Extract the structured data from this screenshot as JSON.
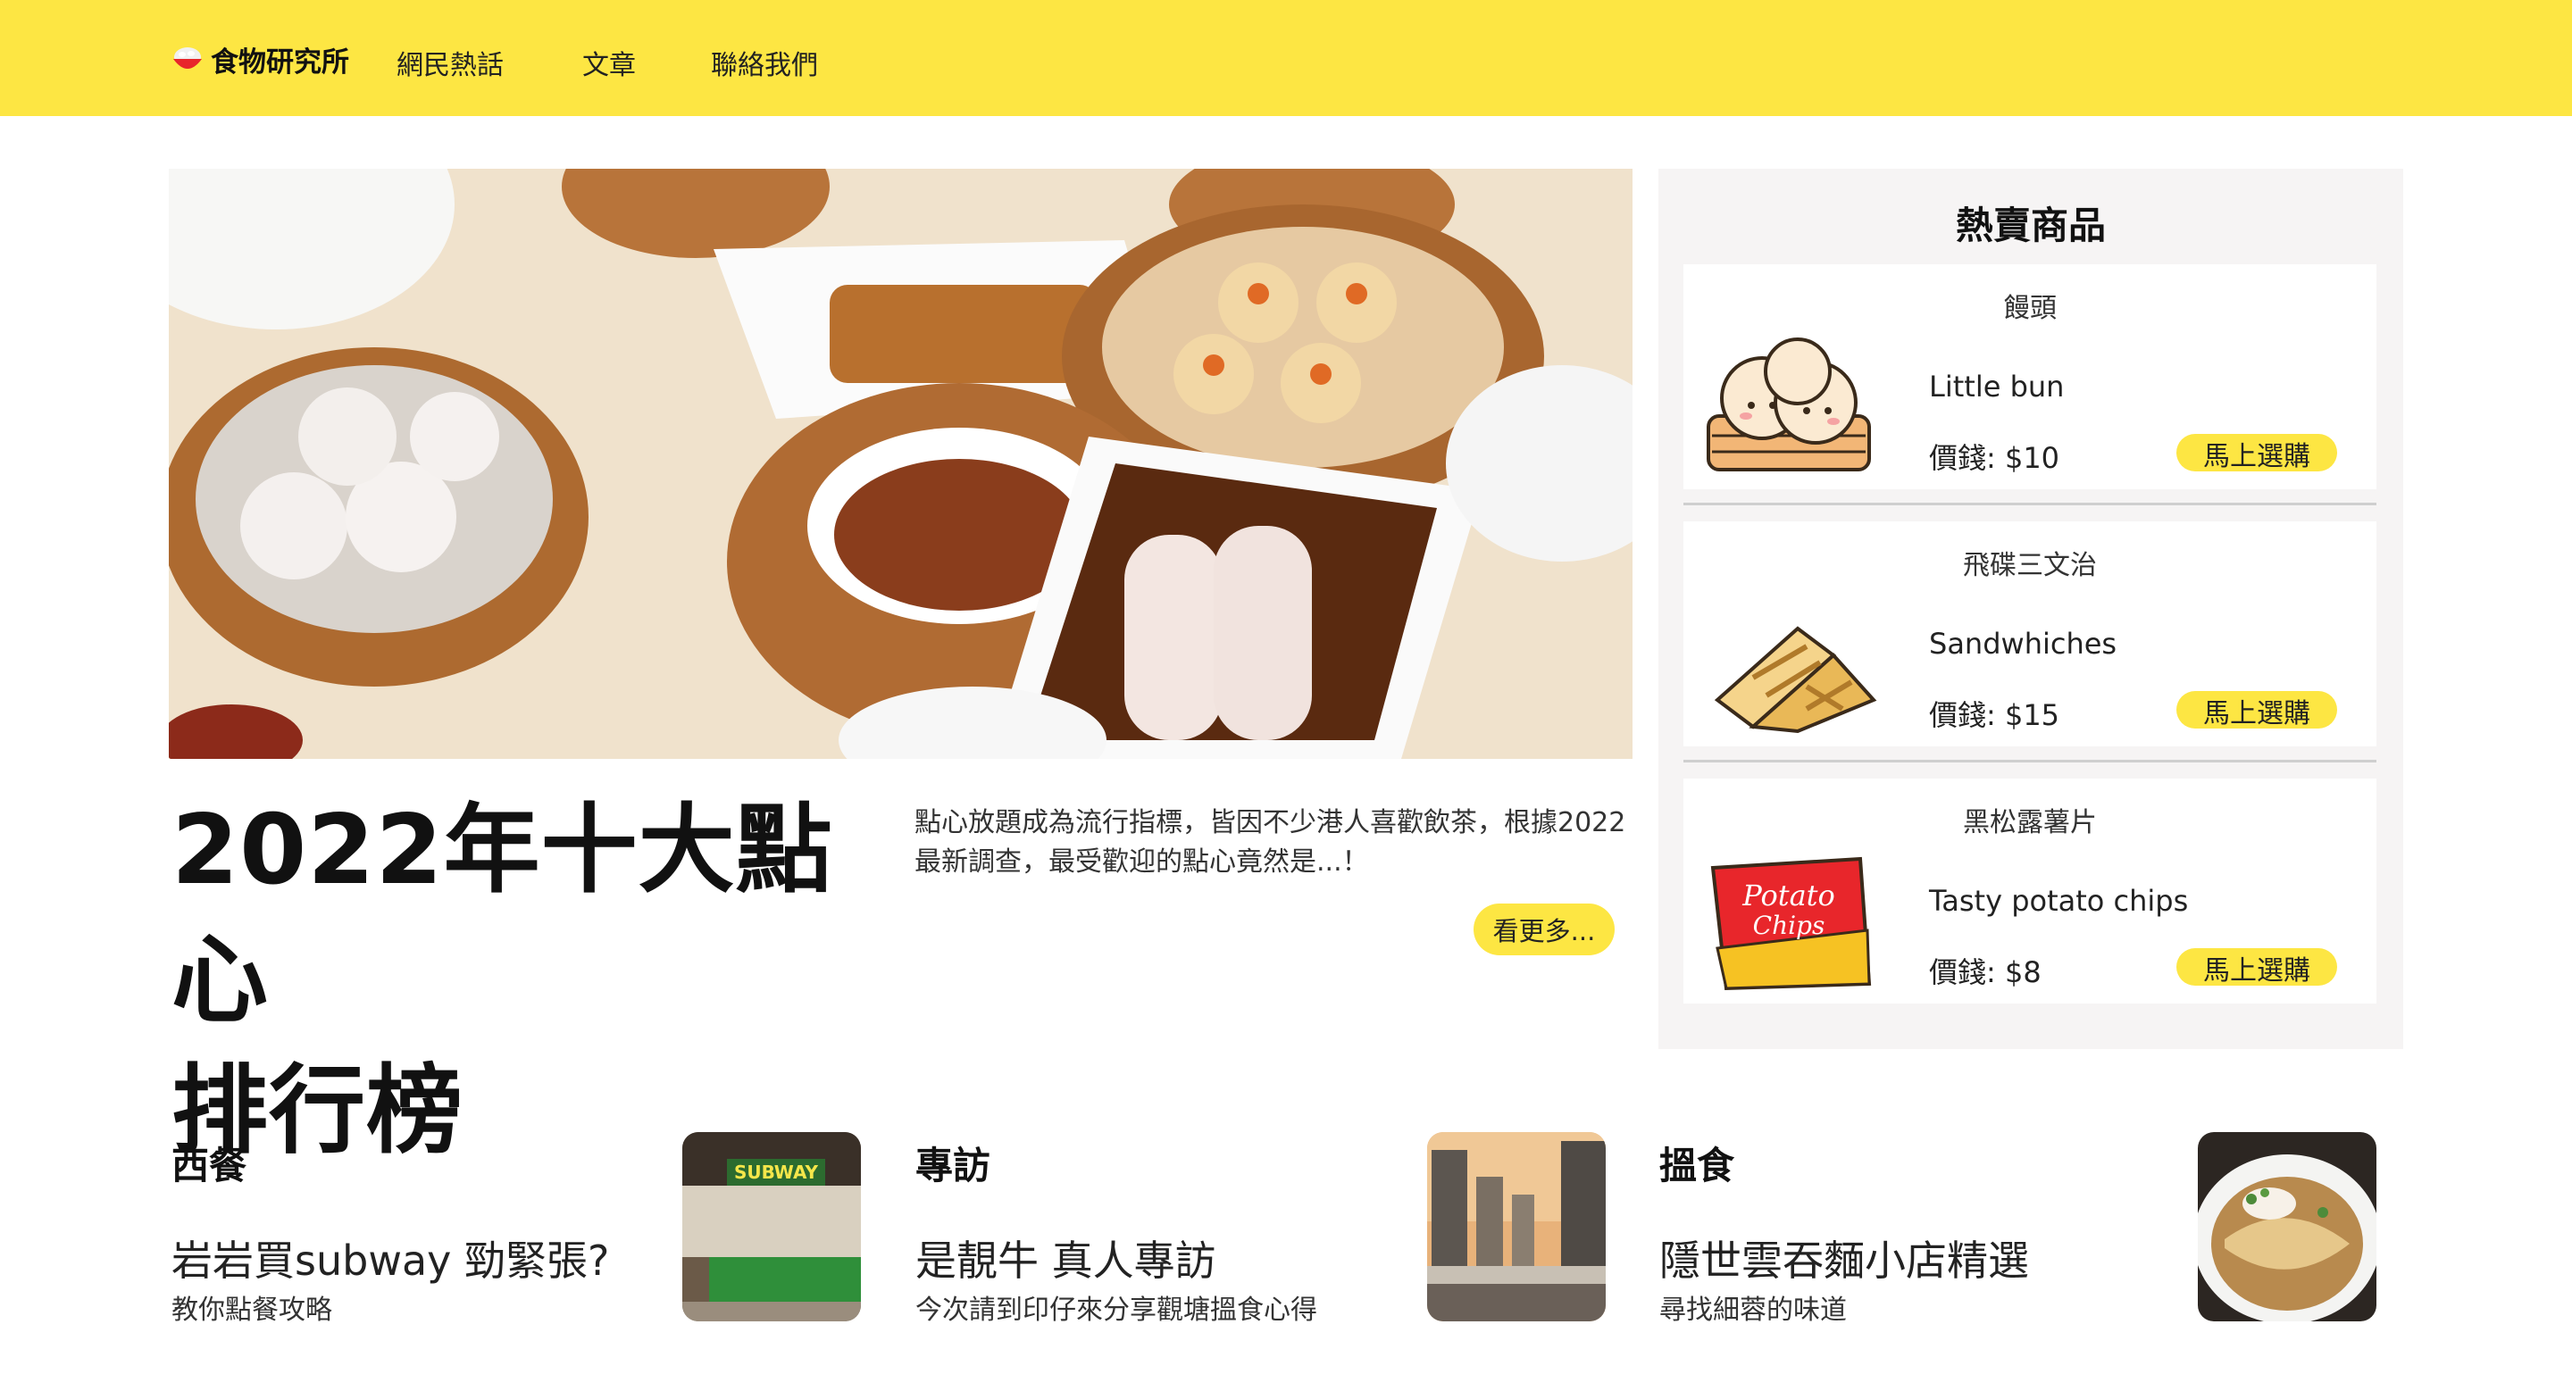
{
  "header": {
    "brand": "食物研究所",
    "nav": [
      "網民熱話",
      "文章",
      "聯絡我們"
    ]
  },
  "hero": {
    "title_line1": "2022年十大點心",
    "title_line2": "排行榜",
    "description": "點心放題成為流行指標，皆因不少港人喜歡飲茶，根據2022最新調查，最受歡迎的點心竟然是...！",
    "more_label": "看更多..."
  },
  "hot": {
    "title": "熱賣商品",
    "items": [
      {
        "name_cn": "饅頭",
        "name_en": "Little bun",
        "price": "價錢: $10",
        "buy_label": "馬上選購",
        "icon": "steamed-bun-icon"
      },
      {
        "name_cn": "飛碟三文治",
        "name_en": "Sandwhiches",
        "price": "價錢: $15",
        "buy_label": "馬上選購",
        "icon": "sandwich-icon"
      },
      {
        "name_cn": "黑松露薯片",
        "name_en": "Tasty potato chips",
        "price": "價錢: $8",
        "buy_label": "馬上選購",
        "icon": "potato-chips-icon",
        "packet_text_1": "Potato",
        "packet_text_2": "Chips"
      }
    ]
  },
  "articles": [
    {
      "category": "西餐",
      "title": "岩岩買subway 勁緊張?",
      "subtitle": "教你點餐攻略",
      "sign": "SUBWAY"
    },
    {
      "category": "專訪",
      "title": "是靚牛 真人專訪",
      "subtitle": "今次請到印仔來分享觀塘搵食心得"
    },
    {
      "category": "搵食",
      "title": "隱世雲吞麵小店精選",
      "subtitle": "尋找細蓉的味道"
    }
  ],
  "colors": {
    "accent": "#fde643",
    "panel": "#f6f4f4"
  }
}
